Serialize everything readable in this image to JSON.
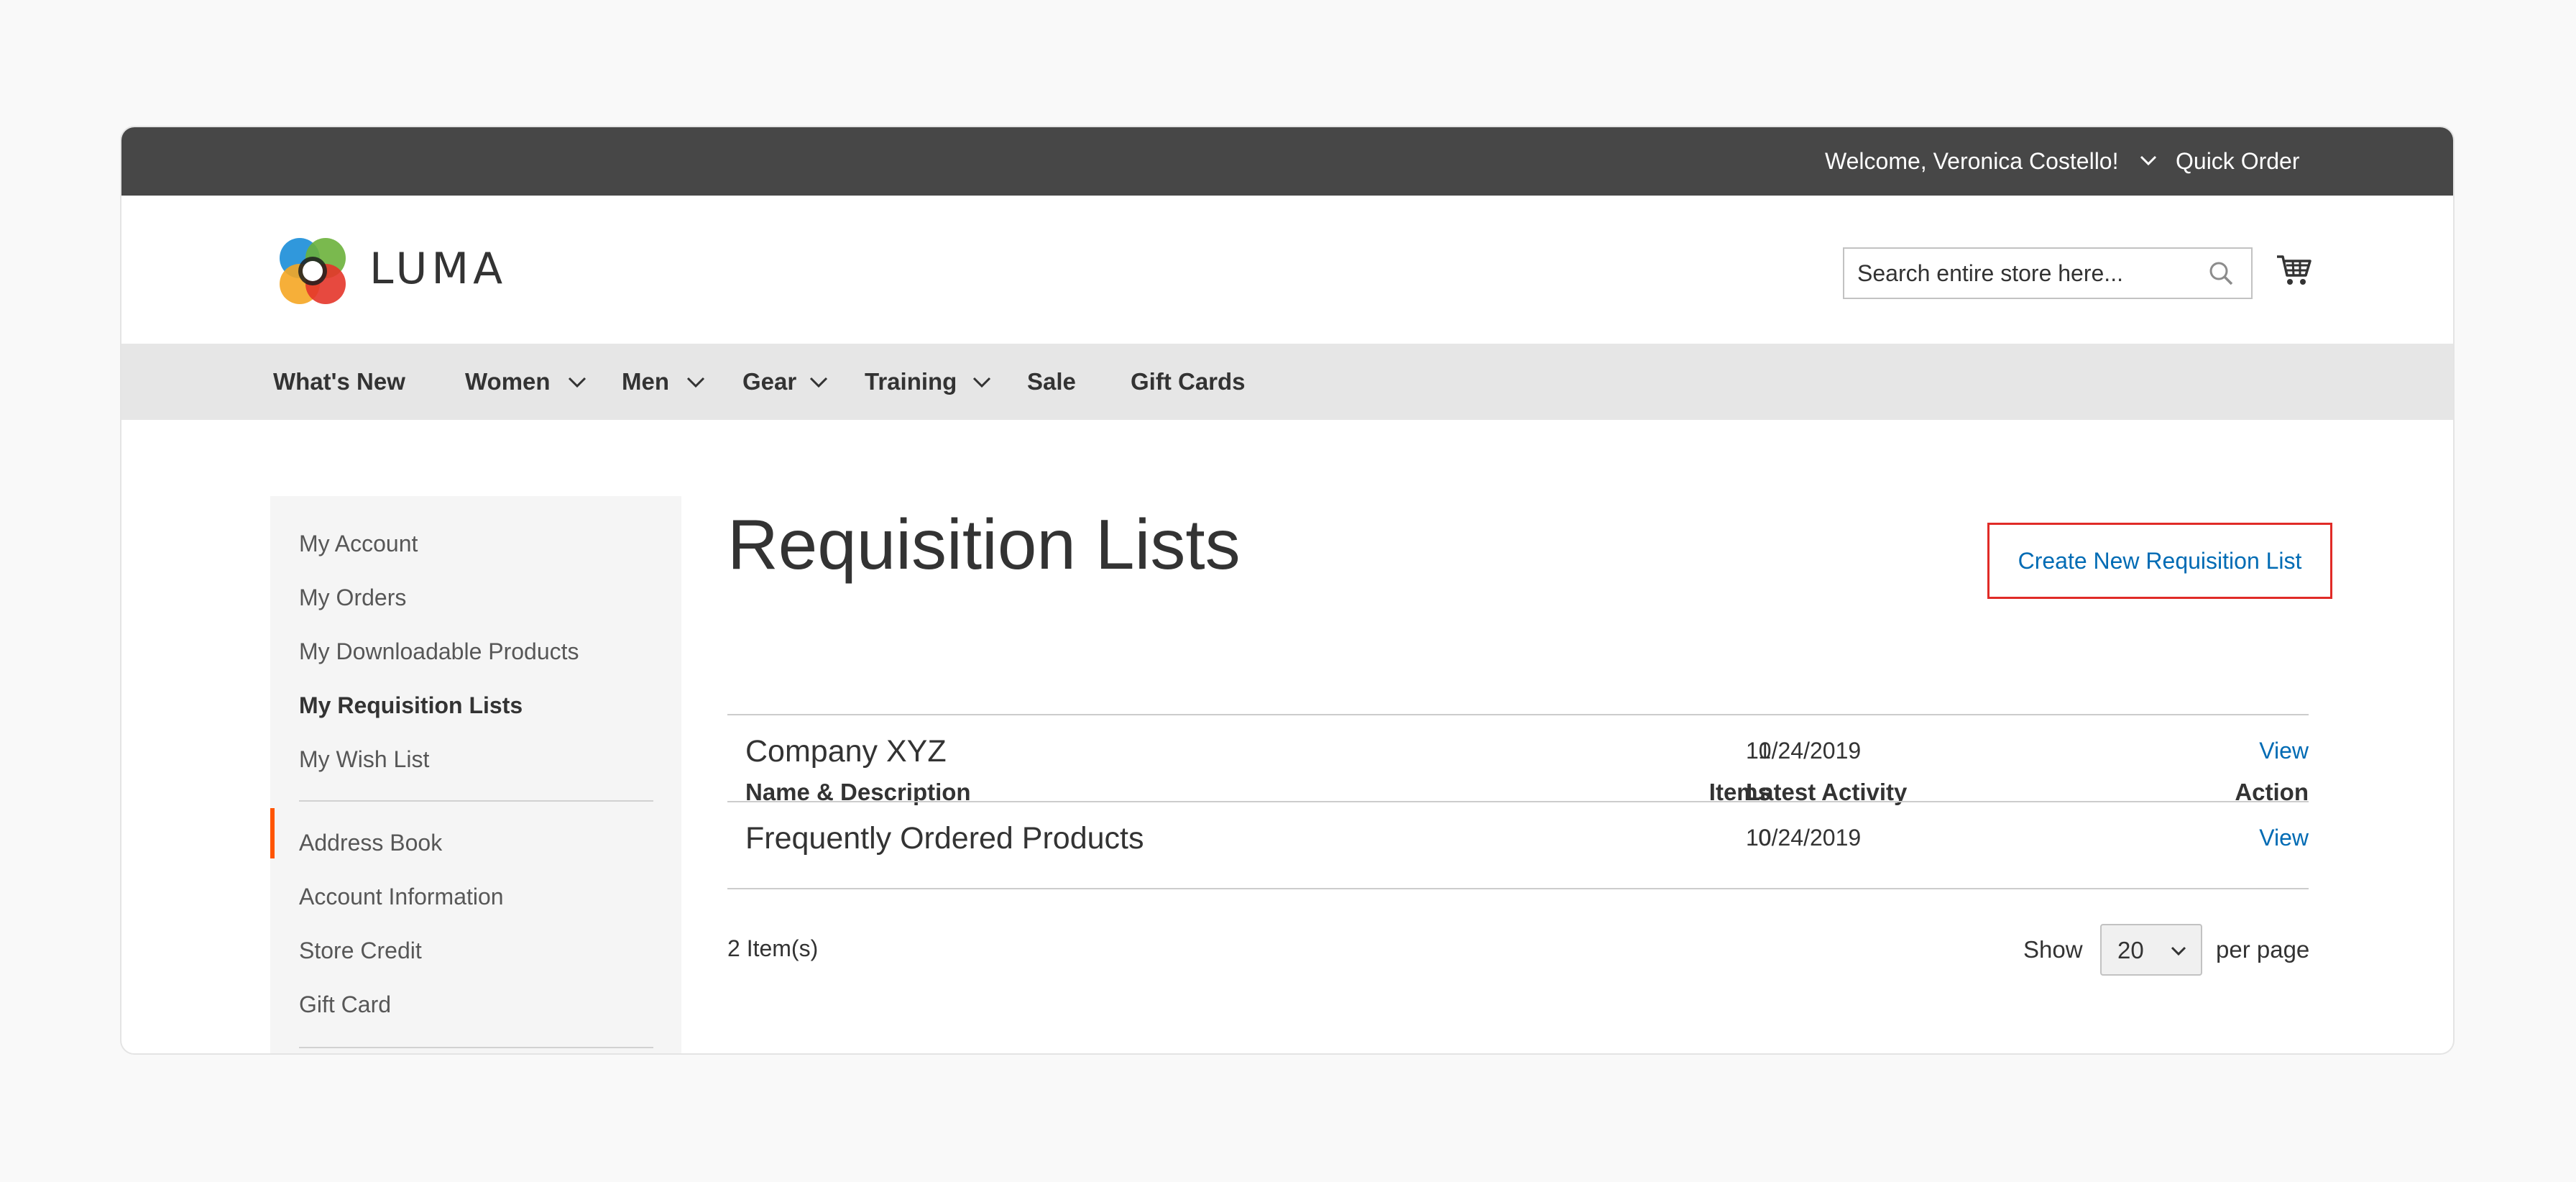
{
  "header": {
    "welcome": "Welcome, Veronica Costello!",
    "quick_order": "Quick Order",
    "logo_text": "LUMA",
    "search_placeholder": "Search entire store here..."
  },
  "nav": {
    "items": [
      "What's New",
      "Women",
      "Men",
      "Gear",
      "Training",
      "Sale",
      "Gift Cards"
    ]
  },
  "sidebar": {
    "group1": [
      "My Account",
      "My Orders",
      "My Downloadable Products",
      "My Requisition Lists",
      "My Wish List"
    ],
    "group2": [
      "Address Book",
      "Account Information",
      "Store Credit",
      "Gift Card"
    ],
    "active": "My Requisition Lists"
  },
  "main": {
    "title": "Requisition Lists",
    "create_button": "Create New Requisition List",
    "columns": [
      "Name & Description",
      "Items",
      "Latest Activity",
      "Action"
    ],
    "rows": [
      {
        "name": "Company XYZ",
        "items": "1",
        "latest": "10/24/2019",
        "action": "View"
      },
      {
        "name": "Frequently Ordered Products",
        "items": "0",
        "latest": "10/24/2019",
        "action": "View"
      }
    ],
    "item_count": "2 Item(s)",
    "show_label": "Show",
    "per_page_value": "20",
    "per_page_label": "per page"
  },
  "colors": {
    "topbar": "#474747",
    "navbar": "#e6e6e6",
    "link": "#006bb4",
    "highlight_border": "#e02b27",
    "active_marker": "#ff5501"
  }
}
